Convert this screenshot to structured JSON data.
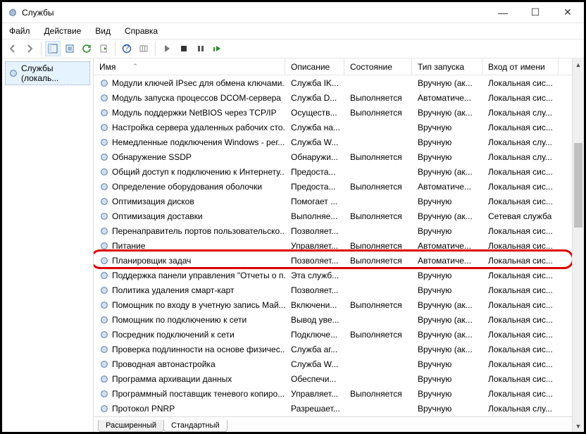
{
  "title": "Службы",
  "menu": [
    "Файл",
    "Действие",
    "Вид",
    "Справка"
  ],
  "sidebar_item": "Службы (локаль...",
  "columns": [
    "Имя",
    "Описание",
    "Состояние",
    "Тип запуска",
    "Вход от имени"
  ],
  "tabs": [
    "Расширенный",
    "Стандартный"
  ],
  "highlight_index": 12,
  "rows": [
    {
      "name": "Модули ключей IPsec для обмена ключами...",
      "desc": "Служба IK...",
      "state": "",
      "startup": "Вручную (ак...",
      "logon": "Локальная сис..."
    },
    {
      "name": "Модуль запуска процессов DCOM-сервера",
      "desc": "Служба D...",
      "state": "Выполняется",
      "startup": "Автоматиче...",
      "logon": "Локальная сис..."
    },
    {
      "name": "Модуль поддержки NetBIOS через TCP/IP",
      "desc": "Осуществ...",
      "state": "Выполняется",
      "startup": "Вручную (ак...",
      "logon": "Локальная слу..."
    },
    {
      "name": "Настройка сервера удаленных рабочих сто...",
      "desc": "Служба на...",
      "state": "",
      "startup": "Вручную",
      "logon": "Локальная сис..."
    },
    {
      "name": "Немедленные подключения Windows - рег...",
      "desc": "Служба W...",
      "state": "",
      "startup": "Вручную",
      "logon": "Локальная слу..."
    },
    {
      "name": "Обнаружение SSDP",
      "desc": "Обнаружи...",
      "state": "Выполняется",
      "startup": "Вручную",
      "logon": "Локальная слу..."
    },
    {
      "name": "Общий доступ к подключению к Интернету...",
      "desc": "Предоста...",
      "state": "",
      "startup": "Вручную (ак...",
      "logon": "Локальная сис..."
    },
    {
      "name": "Определение оборудования оболочки",
      "desc": "Предоста...",
      "state": "Выполняется",
      "startup": "Автоматиче...",
      "logon": "Локальная сис..."
    },
    {
      "name": "Оптимизация дисков",
      "desc": "Помогает ...",
      "state": "",
      "startup": "Вручную",
      "logon": "Локальная сис..."
    },
    {
      "name": "Оптимизация доставки",
      "desc": "Выполняе...",
      "state": "Выполняется",
      "startup": "Вручную (ак...",
      "logon": "Сетевая служба"
    },
    {
      "name": "Перенаправитель портов пользовательско...",
      "desc": "Позволяет...",
      "state": "",
      "startup": "Вручную",
      "logon": "Локальная сис..."
    },
    {
      "name": "Питание",
      "desc": "Управляет...",
      "state": "Выполняется",
      "startup": "Автоматиче...",
      "logon": "Локальная сис..."
    },
    {
      "name": "Планировщик задач",
      "desc": "Позволяет...",
      "state": "Выполняется",
      "startup": "Автоматиче...",
      "logon": "Локальная сис..."
    },
    {
      "name": "Поддержка панели управления \"Отчеты о п...",
      "desc": "Эта служб...",
      "state": "",
      "startup": "Вручную",
      "logon": "Локальная сис..."
    },
    {
      "name": "Политика удаления смарт-карт",
      "desc": "Позволяет...",
      "state": "",
      "startup": "Вручную",
      "logon": "Локальная сис..."
    },
    {
      "name": "Помощник по входу в учетную запись Май...",
      "desc": "Включени...",
      "state": "Выполняется",
      "startup": "Вручную (ак...",
      "logon": "Локальная сис..."
    },
    {
      "name": "Помощник по подключению к сети",
      "desc": "Вывод уве...",
      "state": "",
      "startup": "Вручную (ак...",
      "logon": "Локальная сис..."
    },
    {
      "name": "Посредник подключений к сети",
      "desc": "Подключе...",
      "state": "Выполняется",
      "startup": "Вручную (ак...",
      "logon": "Локальная сис..."
    },
    {
      "name": "Проверка подлинности на основе физичес...",
      "desc": "Служба аг...",
      "state": "",
      "startup": "Вручную (ак...",
      "logon": "Локальная сис..."
    },
    {
      "name": "Проводная автонастройка",
      "desc": "Служба W...",
      "state": "",
      "startup": "Вручную",
      "logon": "Локальная сис..."
    },
    {
      "name": "Программа архивации данных",
      "desc": "Обеспечи...",
      "state": "",
      "startup": "Вручную",
      "logon": "Локальная сис..."
    },
    {
      "name": "Программный поставщик теневого копиро...",
      "desc": "Управляет...",
      "state": "Выполняется",
      "startup": "Вручную",
      "logon": "Локальная сис..."
    },
    {
      "name": "Протокол PNRP",
      "desc": "Разрешает...",
      "state": "",
      "startup": "Вручную",
      "logon": "Локальная слу..."
    }
  ]
}
